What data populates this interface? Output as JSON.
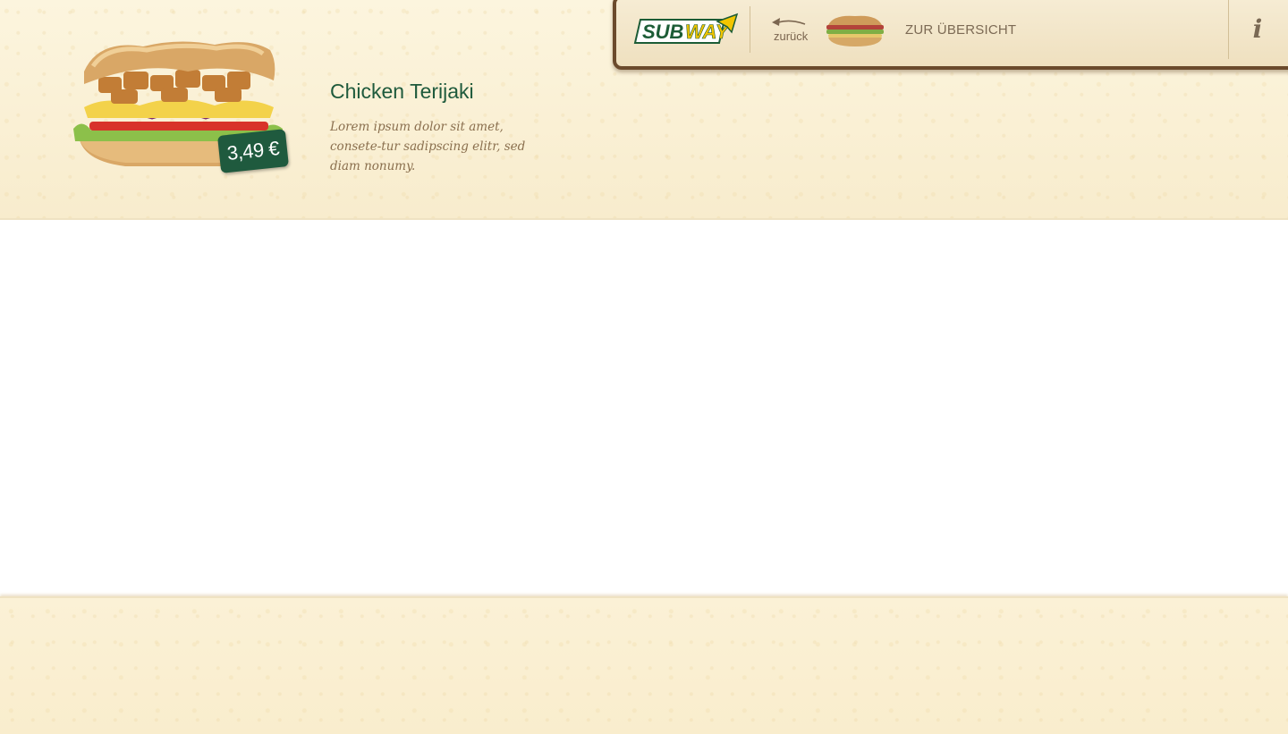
{
  "product": {
    "title": "Chicken Terijaki",
    "description": "Lorem ipsum dolor sit amet, consete-tur sadipscing elitr, sed diam nonumy.",
    "price": "3,49 €"
  },
  "nav": {
    "logo_text": "SUBWAY",
    "back_label": "zurück",
    "overview_label": "ZUR ÜBERSICHT",
    "info_label": "i"
  },
  "colors": {
    "brand_green": "#1f5a3e",
    "brand_yellow": "#f2c500",
    "nav_border": "#6b4a2c",
    "background": "#fbf3da"
  }
}
